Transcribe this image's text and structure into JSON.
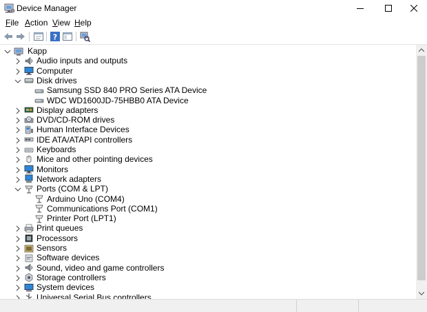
{
  "window": {
    "title": "Device Manager",
    "controls": [
      "minimize-icon",
      "maximize-icon",
      "close-icon"
    ]
  },
  "menu": [
    "File",
    "Action",
    "View",
    "Help"
  ],
  "toolbar": [
    "back-icon",
    "forward-icon",
    "properties-icon",
    "help-icon",
    "show-hide-console-icon",
    "scan-hardware-icon"
  ],
  "tree": {
    "root": "Kapp",
    "categories": [
      {
        "label": "Audio inputs and outputs",
        "expanded": false,
        "icon": "speaker-icon"
      },
      {
        "label": "Computer",
        "expanded": false,
        "icon": "monitor-icon"
      },
      {
        "label": "Disk drives",
        "expanded": true,
        "icon": "disk-drive-icon",
        "children": [
          "Samsung SSD 840 PRO Series ATA Device",
          "WDC WD1600JD-75HBB0 ATA Device"
        ]
      },
      {
        "label": "Display adapters",
        "expanded": false,
        "icon": "display-adapter-icon"
      },
      {
        "label": "DVD/CD-ROM drives",
        "expanded": false,
        "icon": "dvd-drive-icon"
      },
      {
        "label": "Human Interface Devices",
        "expanded": false,
        "icon": "hid-icon"
      },
      {
        "label": "IDE ATA/ATAPI controllers",
        "expanded": false,
        "icon": "ide-controller-icon"
      },
      {
        "label": "Keyboards",
        "expanded": false,
        "icon": "keyboard-icon"
      },
      {
        "label": "Mice and other pointing devices",
        "expanded": false,
        "icon": "mouse-icon"
      },
      {
        "label": "Monitors",
        "expanded": false,
        "icon": "monitor-icon"
      },
      {
        "label": "Network adapters",
        "expanded": false,
        "icon": "network-adapter-icon"
      },
      {
        "label": "Ports (COM & LPT)",
        "expanded": true,
        "icon": "port-icon",
        "children": [
          "Arduino Uno (COM4)",
          "Communications Port (COM1)",
          "Printer Port (LPT1)"
        ]
      },
      {
        "label": "Print queues",
        "expanded": false,
        "icon": "printer-icon"
      },
      {
        "label": "Processors",
        "expanded": false,
        "icon": "processor-icon"
      },
      {
        "label": "Sensors",
        "expanded": false,
        "icon": "sensor-icon"
      },
      {
        "label": "Software devices",
        "expanded": false,
        "icon": "software-device-icon"
      },
      {
        "label": "Sound, video and game controllers",
        "expanded": false,
        "icon": "speaker-icon"
      },
      {
        "label": "Storage controllers",
        "expanded": false,
        "icon": "storage-controller-icon"
      },
      {
        "label": "System devices",
        "expanded": false,
        "icon": "system-device-icon"
      },
      {
        "label": "Universal Serial Bus controllers",
        "expanded": false,
        "icon": "usb-icon"
      }
    ]
  }
}
